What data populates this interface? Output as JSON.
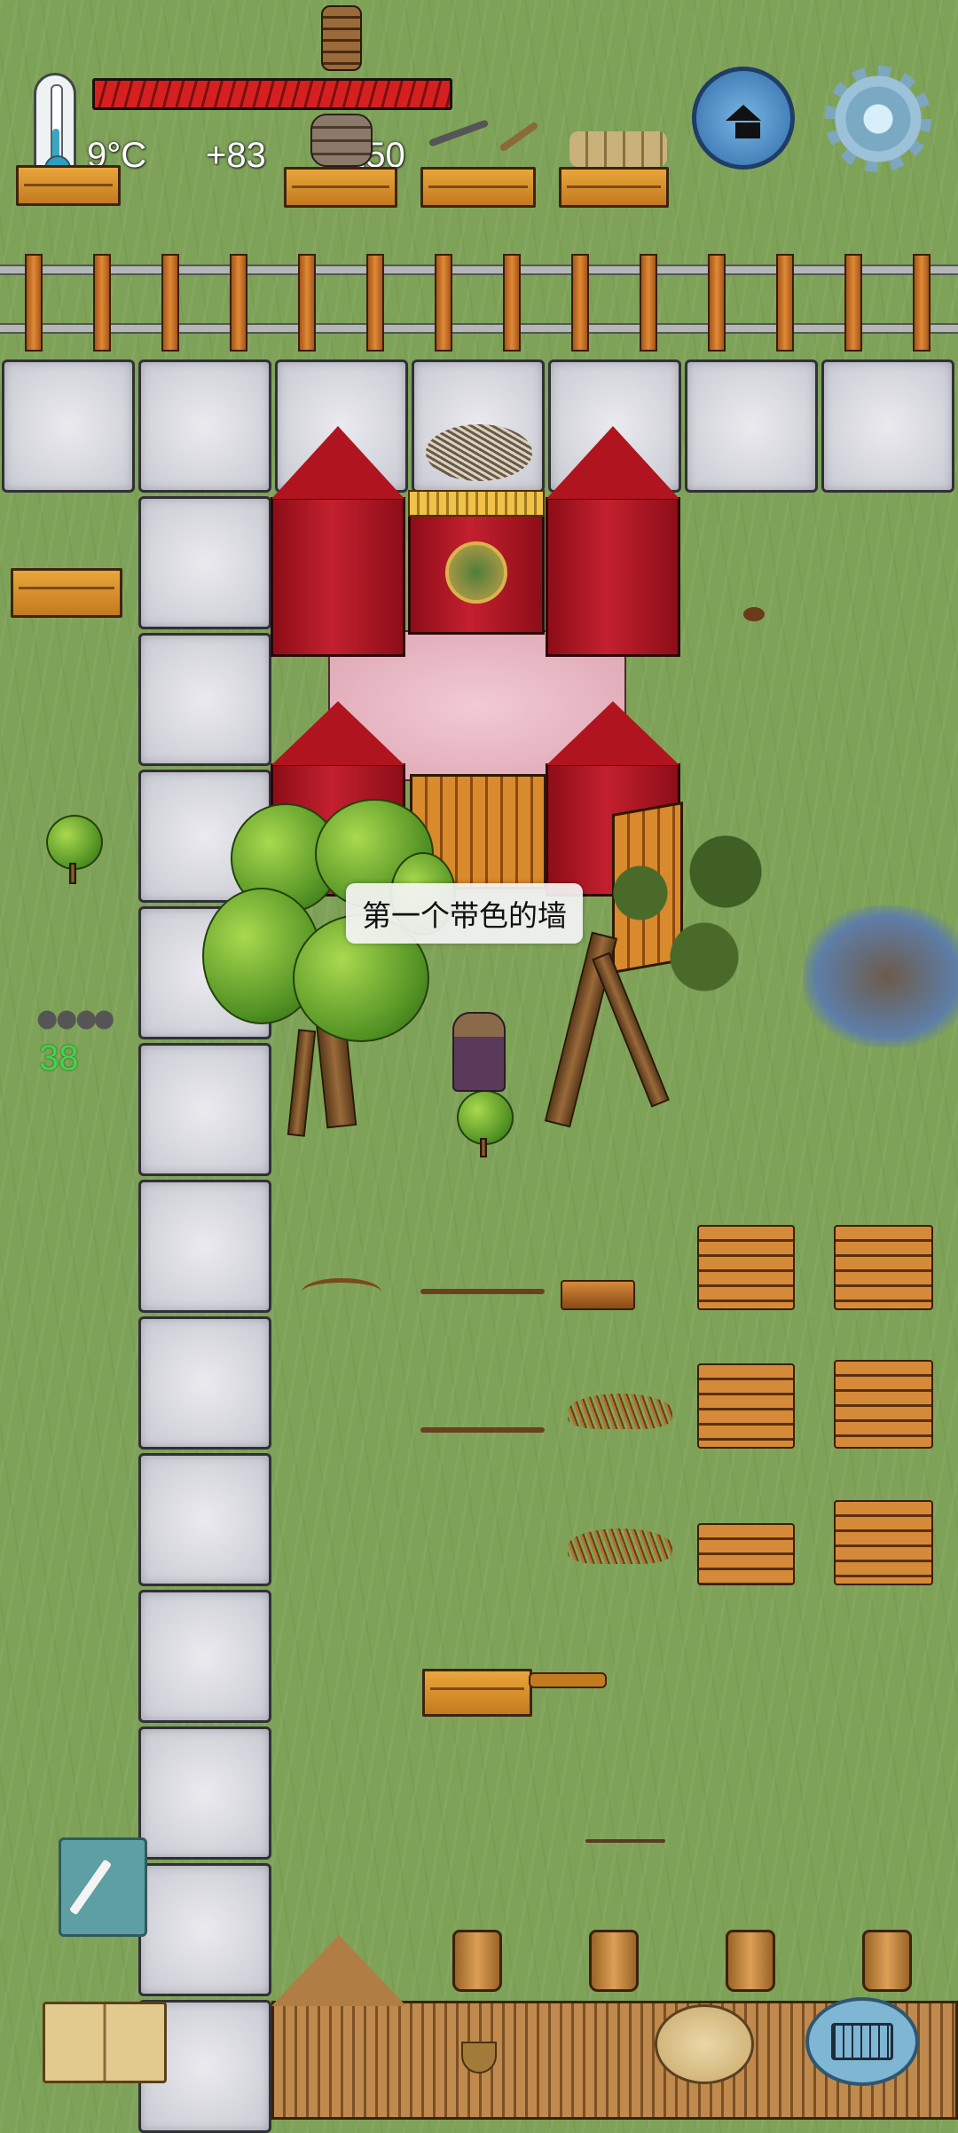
{
  "hud": {
    "temperature": "9°C",
    "food_bonus": "+83",
    "yum_value": "150"
  },
  "world": {
    "wall_label": "第一个带色的墙",
    "pebble_count": "38"
  },
  "buttons": {
    "home": "home-icon",
    "settings": "gear-icon",
    "note": "pencil-icon",
    "tech_book": "book-icon",
    "chat": "keyboard-icon",
    "emote": "potato-face-icon"
  },
  "colors": {
    "grass": "#7ea258",
    "health_bar": "#d62020",
    "wall_red": "#c3202e",
    "count_text": "#3fd64a"
  }
}
